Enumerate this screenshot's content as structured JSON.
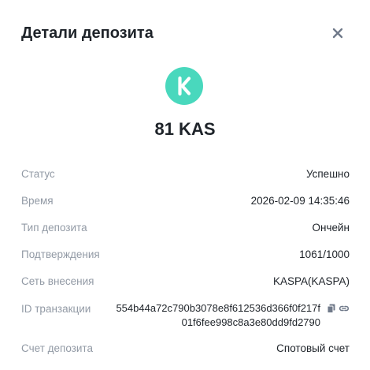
{
  "dialog": {
    "title": "Детали депозита",
    "close_icon": "close-icon"
  },
  "coin": {
    "icon": "kaspa-logo",
    "brand_color": "#49d8bd",
    "amount": "81 KAS"
  },
  "details": {
    "status_label": "Статус",
    "status_value": "Успешно",
    "time_label": "Время",
    "time_value": "2026-02-09 14:35:46",
    "type_label": "Тип депозита",
    "type_value": "Ончейн",
    "confirmations_label": "Подтверждения",
    "confirmations_value": "1061/1000",
    "network_label": "Сеть внесения",
    "network_value": "KASPA(KASPA)",
    "txid_label": "ID транзакции",
    "txid_value": "554b44a72c790b3078e8f612536d366f0f217f01f6fee998c8a3e80dd9fd2790",
    "account_label": "Счет депозита",
    "account_value": "Спотовый счет"
  },
  "icons": {
    "copy": "copy-icon",
    "link": "link-icon"
  }
}
